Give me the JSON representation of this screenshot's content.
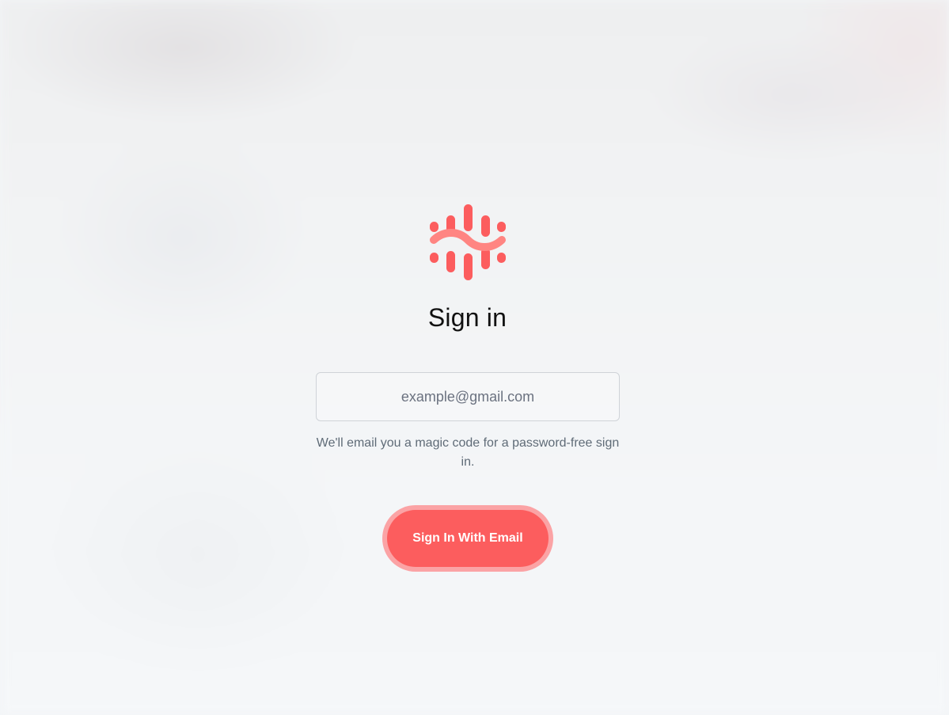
{
  "logo": {
    "icon": "brand-logo-icon",
    "color": "#fc5d5e",
    "wave_color": "#ff8582"
  },
  "signin": {
    "title": "Sign in",
    "email_placeholder": "example@gmail.com",
    "email_value": "",
    "helper_text": "We'll email you a magic code for a password-free sign in.",
    "submit_label": "Sign In With Email"
  },
  "colors": {
    "accent": "#fc5d5e",
    "accent_ring": "#fba3a5",
    "background": "#f3f5f7",
    "helper_text": "#5f6b77"
  }
}
